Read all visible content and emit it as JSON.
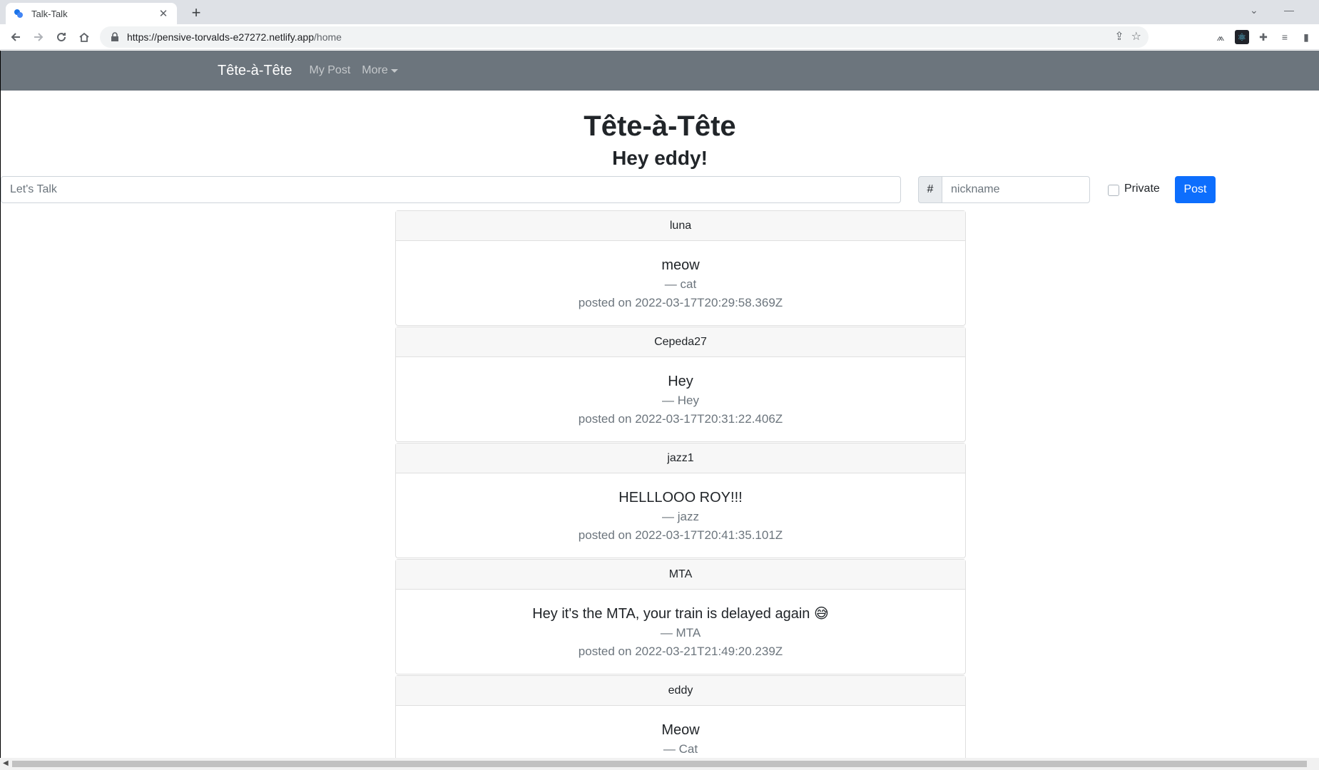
{
  "browser": {
    "tab_title": "Talk-Talk",
    "tab_close": "✕",
    "new_tab": "+",
    "url_main": "https://pensive-torvalds-e27272.netlify.app",
    "url_path": "/home"
  },
  "navbar": {
    "brand": "Tête-à-Tête",
    "links": [
      "My Post",
      "More"
    ]
  },
  "header": {
    "title": "Tête-à-Tête",
    "greeting": "Hey eddy!"
  },
  "form": {
    "talk_placeholder": "Let's Talk",
    "hash_label": "#",
    "nickname_placeholder": "nickname",
    "private_label": "Private",
    "post_label": "Post"
  },
  "posts": [
    {
      "user": "luna",
      "message": "meow",
      "nickname": "— cat",
      "date": "posted on 2022-03-17T20:29:58.369Z"
    },
    {
      "user": "Cepeda27",
      "message": "Hey",
      "nickname": "— Hey",
      "date": "posted on 2022-03-17T20:31:22.406Z"
    },
    {
      "user": "jazz1",
      "message": "HELLLOOO ROY!!!",
      "nickname": "— jazz",
      "date": "posted on 2022-03-17T20:41:35.101Z"
    },
    {
      "user": "MTA",
      "message": "Hey it's the MTA, your train is delayed again 😅",
      "nickname": "— MTA",
      "date": "posted on 2022-03-21T21:49:20.239Z"
    },
    {
      "user": "eddy",
      "message": "Meow",
      "nickname": "— Cat",
      "date": ""
    }
  ],
  "colors": {
    "navbar_bg": "#6c757d",
    "primary": "#0d6efd"
  }
}
